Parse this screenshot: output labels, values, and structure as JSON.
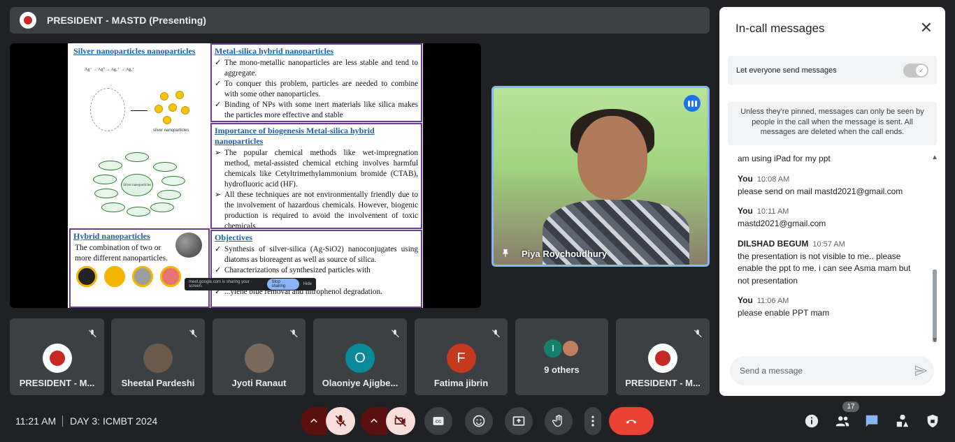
{
  "presenting_bar": {
    "title": "PRESIDENT - MASTD (Presenting)"
  },
  "slide": {
    "silver_heading": "Silver nanoparticles nanoparticles",
    "silver_caption": "silver nanoparticles",
    "silver_center": "Silver nanoparticles",
    "hybrid_heading": "Hybrid nanoparticles",
    "hybrid_text": "The combination of two or more different nanoparticles.",
    "metal_silica_heading": "Metal-silica hybrid nanoparticles",
    "metal_silica_points": [
      "The mono-metallic nanoparticles are less stable and tend to aggregate.",
      "To conquer this problem, particles are needed to combine with some other nanoparticles.",
      "Binding of NPs with some inert materials like silica makes the particles more effective and stable"
    ],
    "importance_heading": "Importance of biogenesis Metal-silica hybrid nanoparticles",
    "importance_points": [
      "The popular chemical methods like wet-impregnation method, metal-assisted chemical etching involves harmful chemicals like Cetyltrimethylammonium bromide (CTAB), hydrofluoric acid (HF).",
      "All these techniques are not environmentally friendly due to the involvement of hazardous chemicals. However, biogenic production is required to avoid the involvement of toxic chemicals."
    ],
    "objectives_heading": "Objectives",
    "objectives_points": [
      "Synthesis of silver-silica (Ag-SiO2) nanoconjugates using diatoms as bioreagent as well as source of silica.",
      "Characterizations of synthesized particles with",
      "...ylene blue removal and nitrophenol degradation."
    ],
    "sharing_text": "meet.google.com is sharing your screen.",
    "stop_sharing": "Stop sharing",
    "hide": "Hide"
  },
  "speaker": {
    "name": "Piya Roychoudhury"
  },
  "participants": [
    {
      "name": "PRESIDENT - M...",
      "avatar": "logo",
      "color": "#ffffff"
    },
    {
      "name": "Sheetal Pardeshi",
      "avatar": "photo",
      "color": "#6b5a4a"
    },
    {
      "name": "Jyoti Ranaut",
      "avatar": "photo",
      "color": "#7a6a5c"
    },
    {
      "name": "Olaoniye Ajigbe...",
      "avatar": "O",
      "color": "#0b8a9c"
    },
    {
      "name": "Fatima jibrin",
      "avatar": "F",
      "color": "#c5391d"
    },
    {
      "name": "9 others",
      "avatar": "I",
      "color": "#12806d"
    },
    {
      "name": "PRESIDENT - M...",
      "avatar": "logo",
      "color": "#ffffff"
    }
  ],
  "panel": {
    "title": "In-call messages",
    "toggle_label": "Let everyone send messages",
    "notice": "Unless they're pinned, messages can only be seen by people in the call when the message is sent. All messages are deleted when the call ends.",
    "partial_message": "am using iPad for my ppt",
    "messages": [
      {
        "sender": "You",
        "time": "10:08 AM",
        "text": "please send on mail mastd2021@gmail.com"
      },
      {
        "sender": "You",
        "time": "10:11 AM",
        "text": "mastd2021@gmail.com"
      },
      {
        "sender": "DILSHAD BEGUM",
        "time": "10:57 AM",
        "text": "the presentation is not visible to me.. please enable the ppt to me. i can see Asma mam but not presentation"
      },
      {
        "sender": "You",
        "time": "11:06 AM",
        "text": "please enable PPT mam"
      }
    ],
    "compose_placeholder": "Send a message"
  },
  "bottom_bar": {
    "time": "11:21 AM",
    "meeting_name": "DAY 3: ICMBT 2024",
    "people_count": "17"
  },
  "colors": {
    "end_call": "#ea4335",
    "muted_bg": "#f9dedc",
    "accent": "#8ab4f8"
  }
}
